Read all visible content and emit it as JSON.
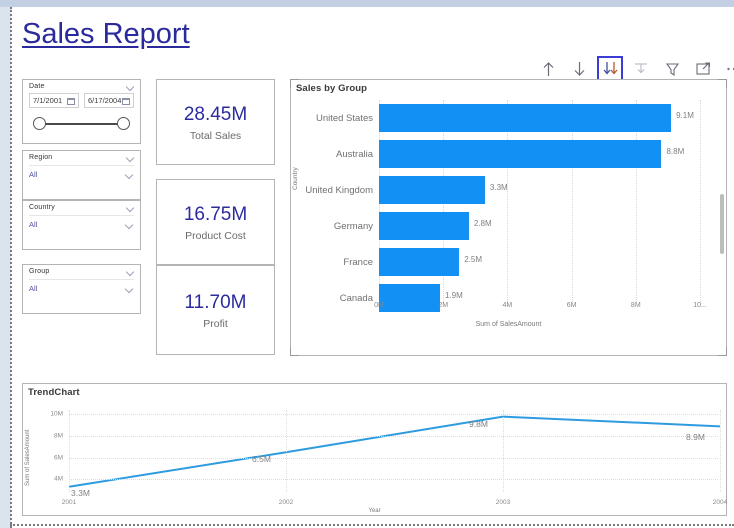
{
  "report": {
    "title": "Sales Report"
  },
  "slicers": {
    "date": {
      "label": "Date",
      "start": "7/1/2001",
      "end": "6/17/2004"
    },
    "dropdowns": [
      {
        "label": "Region",
        "value": "All"
      },
      {
        "label": "Country",
        "value": "All"
      },
      {
        "label": "Group",
        "value": "All"
      }
    ]
  },
  "cards": [
    {
      "value": "28.45M",
      "caption": "Total Sales"
    },
    {
      "value": "16.75M",
      "caption": "Product Cost"
    },
    {
      "value": "11.70M",
      "caption": "Profit"
    }
  ],
  "toolbar": {
    "buttons": [
      {
        "name": "drill-up-icon",
        "title": "Drill up",
        "active": false
      },
      {
        "name": "drill-down-icon",
        "title": "Drill down",
        "active": false
      },
      {
        "name": "expand-all-down-icon",
        "title": "Expand all down one level",
        "active": true
      },
      {
        "name": "go-to-next-level-icon",
        "title": "Go to the next level",
        "active": false
      },
      {
        "name": "filter-icon",
        "title": "Filters",
        "active": false
      },
      {
        "name": "focus-mode-icon",
        "title": "Focus mode",
        "active": false
      },
      {
        "name": "more-options-icon",
        "title": "More options",
        "active": false
      }
    ]
  },
  "chart_data": [
    {
      "type": "bar",
      "title": "Sales by Group",
      "orientation": "horizontal",
      "categories": [
        "United States",
        "Australia",
        "United Kingdom",
        "Germany",
        "France",
        "Canada"
      ],
      "values": [
        9.1,
        8.8,
        3.3,
        2.8,
        2.5,
        1.9
      ],
      "value_labels": [
        "9.1M",
        "8.8M",
        "3.3M",
        "2.8M",
        "2.5M",
        "1.9M"
      ],
      "xlabel": "Sum of SalesAmount",
      "ylabel": "Country",
      "xlim": [
        0,
        10
      ],
      "xticks": [
        0,
        2,
        4,
        6,
        8,
        10
      ],
      "xtick_labels": [
        "0M",
        "2M",
        "4M",
        "6M",
        "8M",
        "10..."
      ],
      "grid": true,
      "legend": "none",
      "bar_color": "#1290f3"
    },
    {
      "type": "line",
      "title": "TrendChart",
      "x": [
        "2001",
        "2002",
        "2003",
        "2004"
      ],
      "values": [
        3.3,
        6.5,
        9.8,
        8.9
      ],
      "value_labels": [
        "3.3M",
        "6.5M",
        "9.8M",
        "8.9M"
      ],
      "xlabel": "Year",
      "ylabel": "Sum of SalesAmount",
      "ylim": [
        3,
        10.6
      ],
      "yticks": [
        4,
        6,
        8,
        10
      ],
      "ytick_labels": [
        "4M",
        "6M",
        "8M",
        "10M"
      ],
      "grid": true,
      "legend": "none",
      "line_color": "#2e9bdf"
    }
  ]
}
